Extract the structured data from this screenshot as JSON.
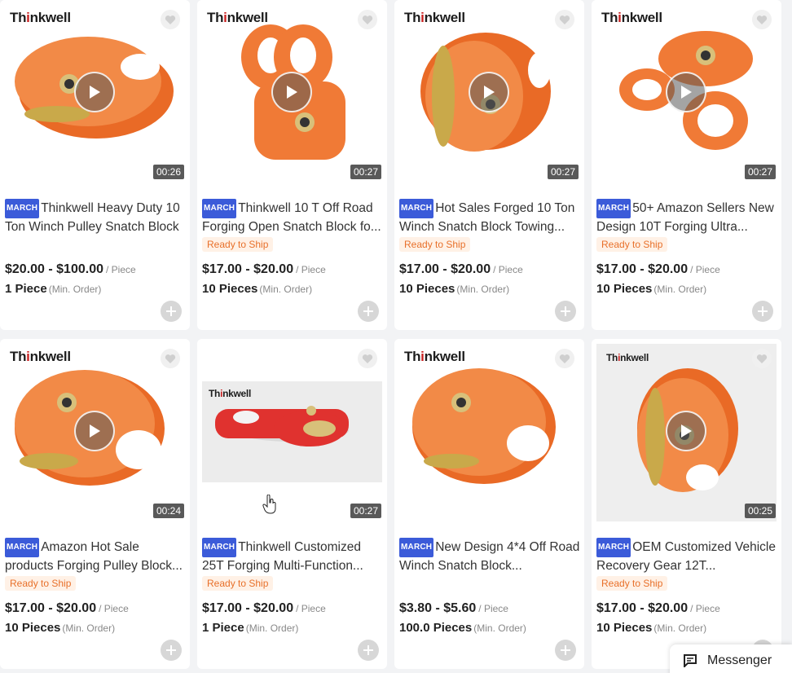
{
  "colors": {
    "orange": "#f07a36",
    "accent_badge": "#3b5bd9",
    "ready_bg": "#fff1e6",
    "ready_text": "#e8702a",
    "brand_red": "#c81e1e"
  },
  "brand": {
    "prefix": "Th",
    "accent": "i",
    "suffix": "nkwell"
  },
  "cards": [
    {
      "badge": "MARCH",
      "title": "Thinkwell Heavy Duty 10 Ton Winch Pulley Snatch Block",
      "ready": "",
      "price": "$20.00 - $100.00",
      "unit": "/ Piece",
      "moq": "1 Piece",
      "moq_note": "(Min. Order)",
      "duration": "00:26"
    },
    {
      "badge": "MARCH",
      "title": "Thinkwell 10 T Off Road Forging Open Snatch Block fo...",
      "ready": "Ready to Ship",
      "price": "$17.00 - $20.00",
      "unit": "/ Piece",
      "moq": "10 Pieces",
      "moq_note": "(Min. Order)",
      "duration": "00:27"
    },
    {
      "badge": "MARCH",
      "title": "Hot Sales Forged 10 Ton Winch Snatch Block Towing...",
      "ready": "Ready to Ship",
      "price": "$17.00 - $20.00",
      "unit": "/ Piece",
      "moq": "10 Pieces",
      "moq_note": "(Min. Order)",
      "duration": "00:27"
    },
    {
      "badge": "MARCH",
      "title": "50+ Amazon Sellers New Design 10T Forging Ultra...",
      "ready": "Ready to Ship",
      "price": "$17.00 - $20.00",
      "unit": "/ Piece",
      "moq": "10 Pieces",
      "moq_note": "(Min. Order)",
      "duration": "00:27"
    },
    {
      "badge": "MARCH",
      "title": "Amazon Hot Sale products Forging Pulley Block...",
      "ready": "Ready to Ship",
      "price": "$17.00 - $20.00",
      "unit": "/ Piece",
      "moq": "10 Pieces",
      "moq_note": "(Min. Order)",
      "duration": "00:24"
    },
    {
      "badge": "MARCH",
      "title": "Thinkwell Customized 25T Forging Multi-Function...",
      "ready": "Ready to Ship",
      "price": "$17.00 - $20.00",
      "unit": "/ Piece",
      "moq": "1 Piece",
      "moq_note": "(Min. Order)",
      "duration": "00:27"
    },
    {
      "badge": "MARCH",
      "title": "New Design 4*4 Off Road Winch Snatch Block...",
      "ready": "",
      "price": "$3.80 - $5.60",
      "unit": "/ Piece",
      "moq": "100.0 Pieces",
      "moq_note": "(Min. Order)",
      "duration": ""
    },
    {
      "badge": "MARCH",
      "title": "OEM Customized Vehicle Recovery Gear 12T...",
      "ready": "Ready to Ship",
      "price": "$17.00 - $20.00",
      "unit": "/ Piece",
      "moq": "10 Pieces",
      "moq_note": "(Min. Order)",
      "duration": "00:25"
    }
  ],
  "messenger": {
    "label": "Messenger"
  },
  "icons": {
    "heart": "heart-icon",
    "play": "play-icon",
    "add": "plus-icon",
    "messenger": "chat-icon"
  }
}
